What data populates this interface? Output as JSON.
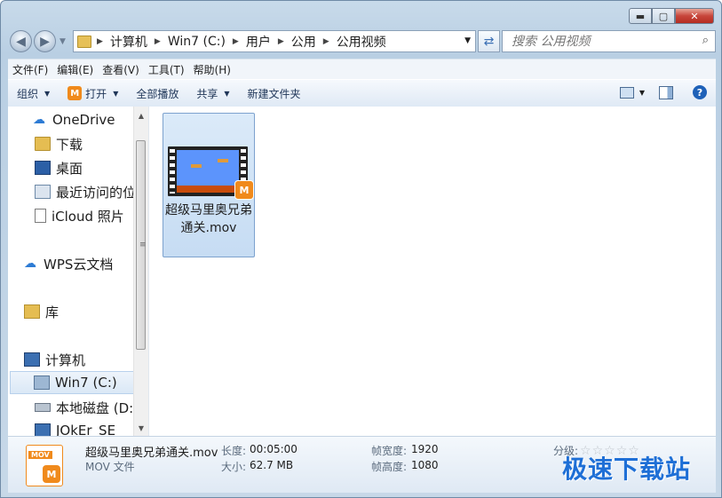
{
  "window": {
    "caption": {
      "minimize": "▬",
      "maximize": "▢",
      "close": "✕"
    }
  },
  "nav": {
    "breadcrumbs": [
      "计算机",
      "Win7 (C:)",
      "用户",
      "公用",
      "公用视频"
    ],
    "search_placeholder": "搜索 公用视频"
  },
  "menu": [
    "文件(F)",
    "编辑(E)",
    "查看(V)",
    "工具(T)",
    "帮助(H)"
  ],
  "toolbar": {
    "organize": "组织",
    "open": "打开",
    "play_all": "全部播放",
    "share": "共享",
    "new_folder": "新建文件夹"
  },
  "navpane": {
    "items": [
      {
        "label": "OneDrive",
        "icon": "cloud-icon"
      },
      {
        "label": "下载",
        "icon": "download-folder-icon"
      },
      {
        "label": "桌面",
        "icon": "desktop-icon"
      },
      {
        "label": "最近访问的位",
        "icon": "recent-places-icon"
      },
      {
        "label": "iCloud 照片",
        "icon": "file-icon"
      },
      {
        "label": "WPS云文档",
        "icon": "wps-cloud-icon"
      },
      {
        "label": "库",
        "icon": "library-icon"
      },
      {
        "label": "计算机",
        "icon": "computer-icon"
      },
      {
        "label": "Win7 (C:)",
        "icon": "windows-drive-icon",
        "selected": true
      },
      {
        "label": "本地磁盘 (D:",
        "icon": "drive-icon"
      },
      {
        "label": "JOkEr_SE",
        "icon": "drive-icon"
      }
    ]
  },
  "files": [
    {
      "name": "超级马里奥兄弟通关.mov",
      "badge": "M"
    }
  ],
  "details": {
    "filename": "超级马里奥兄弟通关.mov",
    "type": "MOV 文件",
    "duration_label": "长度:",
    "duration": "00:05:00",
    "size_label": "大小:",
    "size": "62.7 MB",
    "width_label": "帧宽度:",
    "width": "1920",
    "height_label": "帧高度:",
    "height": "1080",
    "rating_label": "分级:",
    "rating": 0,
    "icon_tag": "MOV",
    "icon_badge": "M"
  },
  "watermark": "极速下载站",
  "colors": {
    "accent": "#f08a1c",
    "selection": "#c6dcf3",
    "link": "#1e6fd6"
  }
}
